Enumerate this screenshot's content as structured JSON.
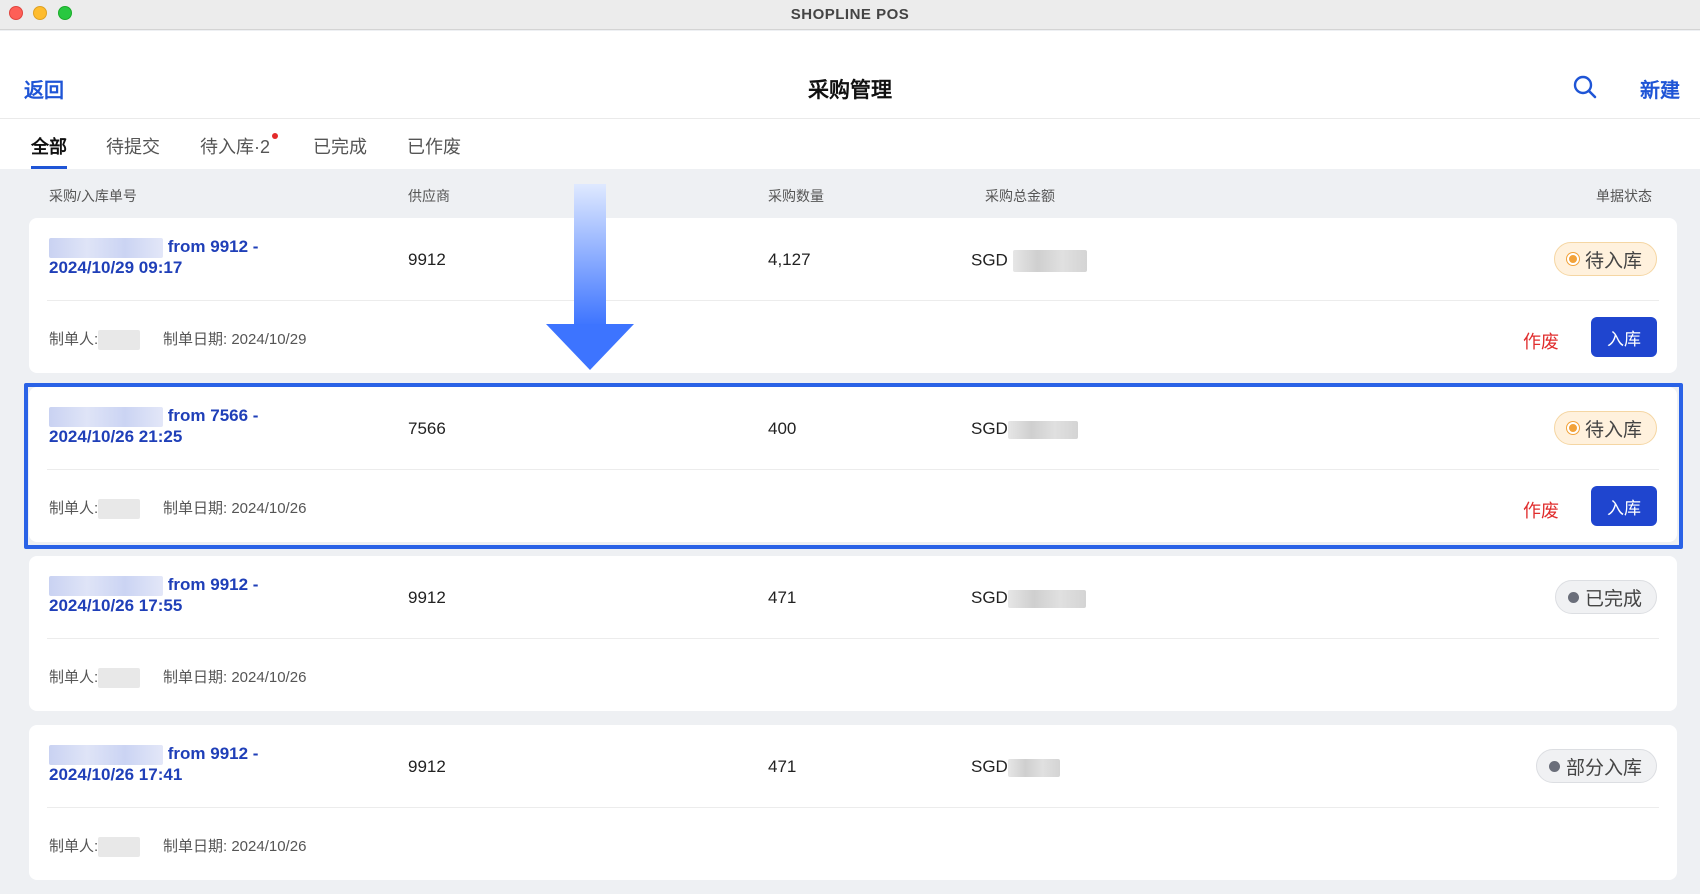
{
  "window": {
    "title": "SHOPLINE POS"
  },
  "header": {
    "back_label": "返回",
    "title": "采购管理",
    "new_label": "新建",
    "search_icon": "search-icon"
  },
  "tabs": [
    {
      "label": "全部",
      "active": true
    },
    {
      "label": "待提交"
    },
    {
      "label": "待入库·2",
      "has_dot": true
    },
    {
      "label": "已完成"
    },
    {
      "label": "已作废"
    }
  ],
  "columns": [
    "采购/入库单号",
    "供应商",
    "采购数量",
    "采购总金额",
    "单据状态"
  ],
  "orders": [
    {
      "id_suffix": "from 9912 -",
      "datetime": "2024/10/29 09:17",
      "supplier": "9912",
      "quantity": "4,127",
      "currency": "SGD",
      "creator_label": "制单人:",
      "date_label": "制单日期: 2024/10/29",
      "status": "待入库",
      "void_label": "作废",
      "stock_label": "入库"
    },
    {
      "id_suffix": "from 7566 -",
      "datetime": "2024/10/26 21:25",
      "supplier": "7566",
      "quantity": "400",
      "currency": "SGD",
      "creator_label": "制单人:",
      "date_label": "制单日期: 2024/10/26",
      "status": "待入库",
      "void_label": "作废",
      "stock_label": "入库"
    },
    {
      "id_suffix": "from 9912 -",
      "datetime": "2024/10/26 17:55",
      "supplier": "9912",
      "quantity": "471",
      "currency": "SGD",
      "creator_label": "制单人:",
      "date_label": "制单日期: 2024/10/26",
      "status": "已完成"
    },
    {
      "id_suffix": "from 9912 -",
      "datetime": "2024/10/26 17:41",
      "supplier": "9912",
      "quantity": "471",
      "currency": "SGD",
      "creator_label": "制单人:",
      "date_label": "制单日期: 2024/10/26",
      "status": "部分入库"
    }
  ],
  "colors": {
    "accent": "#1f55d6",
    "danger": "#e02d2d",
    "pending_bg": "#fff1dd",
    "highlight": "#2a62e6"
  }
}
